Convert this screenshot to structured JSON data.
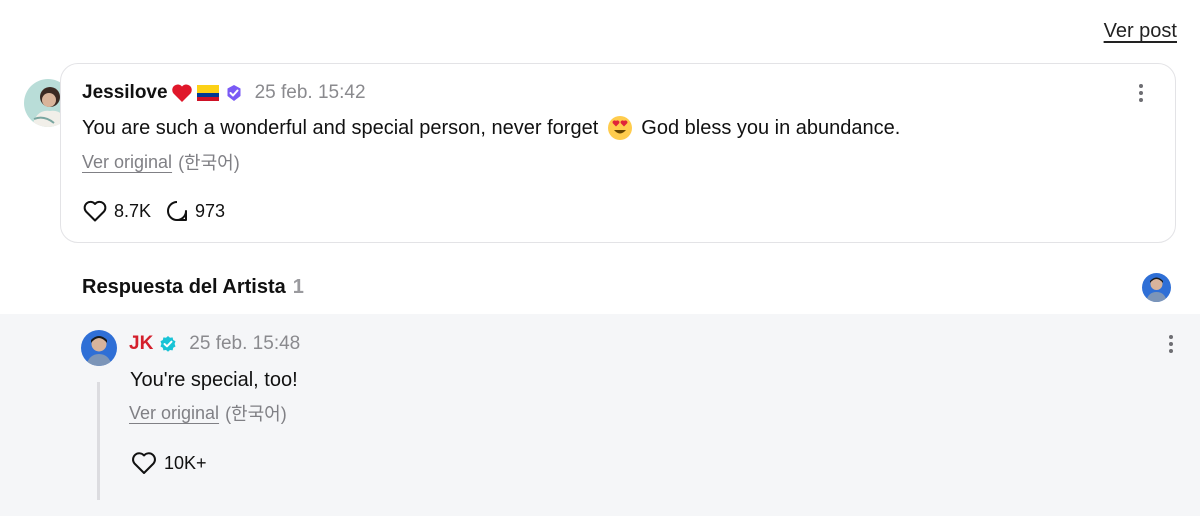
{
  "header": {
    "view_post_label": "Ver post"
  },
  "comment": {
    "username": "Jessilove",
    "timestamp": "25 feb. 15:42",
    "text_before_emoji": "You are such a wonderful and special person, never forget",
    "text_after_emoji": "God bless you in abundance.",
    "view_original_label": "Ver original",
    "original_language": "(한국어)",
    "likes": "8.7K",
    "replies": "973"
  },
  "artist_reply_section": {
    "title": "Respuesta del Artista",
    "count": "1"
  },
  "reply": {
    "username": "JK",
    "timestamp": "25 feb. 15:48",
    "text": "You're special, too!",
    "view_original_label": "Ver original",
    "original_language": "(한국어)",
    "likes": "10K+"
  },
  "colors": {
    "artist_name": "#d41f2c",
    "verified_badge": "#7a5af5",
    "artist_verified_badge": "#19c3d6",
    "reply_background": "#f5f6f8"
  },
  "icons": [
    "heart-icon",
    "colombia-flag-icon",
    "verified-badge-icon",
    "more-options-icon",
    "like-icon",
    "comment-icon",
    "heart-eyes-emoji"
  ]
}
